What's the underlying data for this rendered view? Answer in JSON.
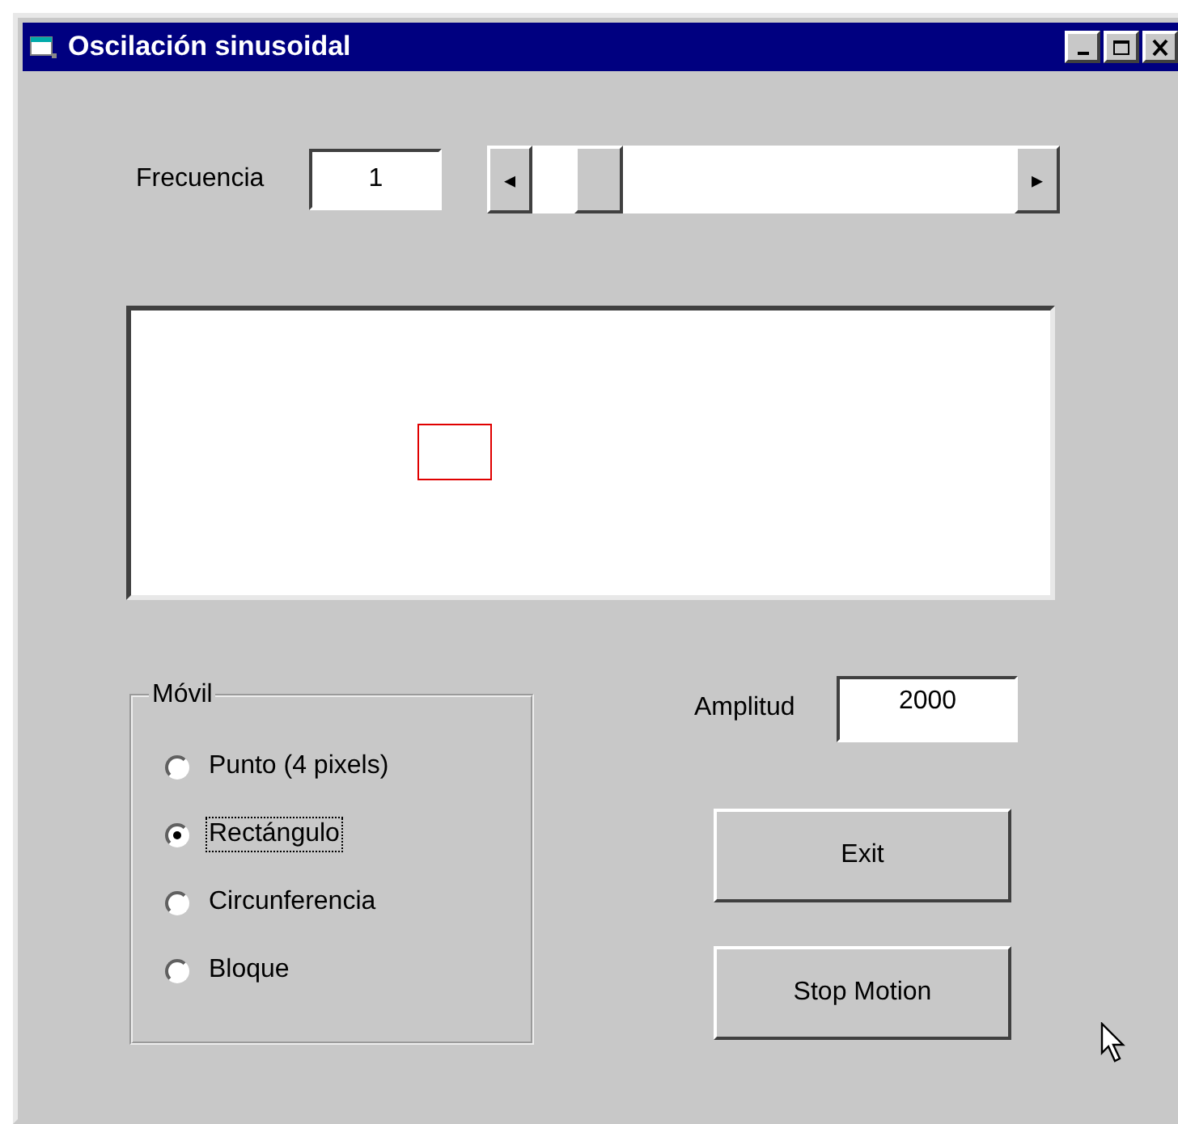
{
  "window": {
    "title": "Oscilación sinusoidal"
  },
  "frequency": {
    "label": "Frecuencia",
    "value": "1",
    "scroll_left": "◂",
    "scroll_right": "▸"
  },
  "group": {
    "title": "Móvil",
    "options": [
      {
        "label": "Punto (4 pixels)",
        "selected": false
      },
      {
        "label": "Rectángulo",
        "selected": true
      },
      {
        "label": "Circunferencia",
        "selected": false
      },
      {
        "label": "Bloque",
        "selected": false
      }
    ]
  },
  "amplitude": {
    "label": "Amplitud",
    "value": "2000"
  },
  "buttons": [
    "Exit",
    "Stop Motion"
  ]
}
